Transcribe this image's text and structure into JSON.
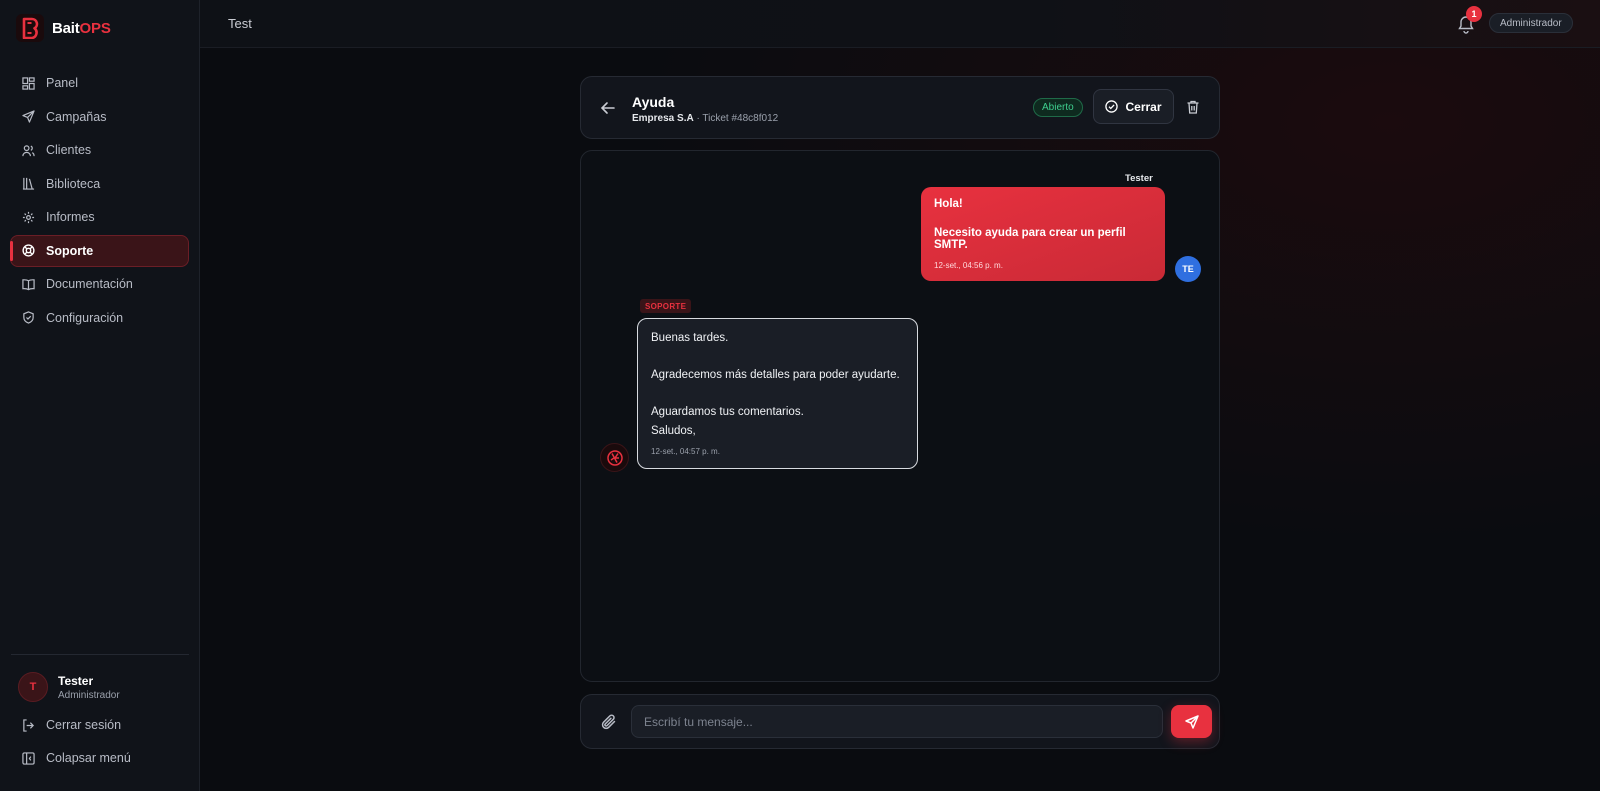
{
  "brand": {
    "name_part1": "Bait",
    "name_part2": "OPS",
    "accent": "#e8313f"
  },
  "topbar": {
    "title": "Test",
    "notification_count": "1",
    "role": "Administrador"
  },
  "sidebar": {
    "items": [
      {
        "label": "Panel",
        "icon": "dashboard-icon"
      },
      {
        "label": "Campañas",
        "icon": "send-icon"
      },
      {
        "label": "Clientes",
        "icon": "users-icon"
      },
      {
        "label": "Biblioteca",
        "icon": "library-icon"
      },
      {
        "label": "Informes",
        "icon": "gear-icon"
      },
      {
        "label": "Soporte",
        "icon": "lifebuoy-icon",
        "active": true
      },
      {
        "label": "Documentación",
        "icon": "book-icon"
      },
      {
        "label": "Configuración",
        "icon": "shield-icon"
      }
    ],
    "user": {
      "initial": "T",
      "name": "Tester",
      "role": "Administrador"
    },
    "logout_label": "Cerrar sesión",
    "collapse_label": "Colapsar menú"
  },
  "ticket": {
    "title": "Ayuda",
    "company": "Empresa S.A",
    "ticket_ref": " · Ticket #48c8f012",
    "status": "Abierto",
    "status_color": "#3ecf8e",
    "close_label": "Cerrar"
  },
  "messages": {
    "outgoing": {
      "sender": "Tester",
      "avatar_initials": "TE",
      "lines": [
        "Hola!",
        "Necesito ayuda para crear un perfil SMTP."
      ],
      "time": "12-set., 04:56 p. m."
    },
    "incoming": {
      "tag": "SOPORTE",
      "lines": [
        "Buenas tardes.",
        "Agradecemos más detalles para poder ayudarte.",
        "Aguardamos tus comentarios.",
        "Saludos,"
      ],
      "time": "12-set., 04:57 p. m."
    }
  },
  "composer": {
    "placeholder": "Escribí tu mensaje..."
  }
}
